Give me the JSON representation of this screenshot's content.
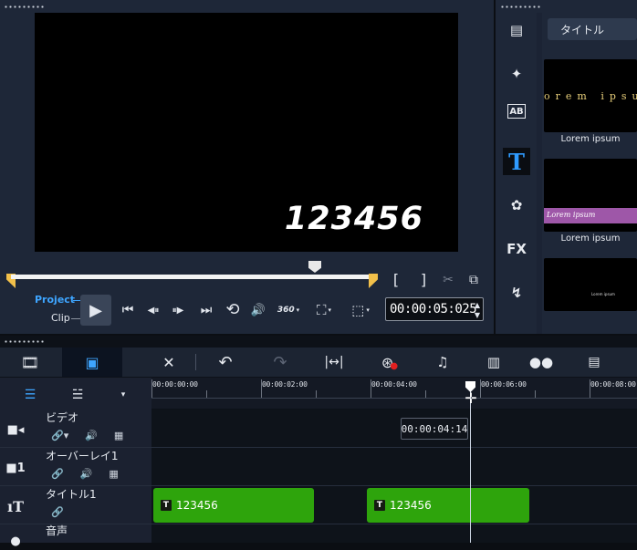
{
  "player": {
    "preview_text": "123456",
    "mode_project": "Project",
    "mode_clip": "Clip",
    "timecode": "00:00:05:025",
    "icons": {
      "play": "▶",
      "prev": "⏮",
      "step_back": "◀⏸",
      "step_fwd": "⏸▶",
      "next": "⏭",
      "repeat": "⟲",
      "volume": "🔊",
      "view360": "360",
      "aspect": "⛶",
      "crop": "⬚",
      "mark_in": "[",
      "mark_out": "]",
      "split": "✂",
      "snapshot": "⧉"
    }
  },
  "library": {
    "dropdown_label": "タイトル",
    "thumbs": [
      {
        "text": "orem ipsu",
        "label": "Lorem ipsum"
      },
      {
        "text": "Lorem ipsum",
        "label": "Lorem ipsum"
      },
      {
        "text": "Lorem ipsum"
      }
    ],
    "rail_title_icon": "T",
    "rail_fx": "FX",
    "rail_ab": "AB"
  },
  "timeline": {
    "ruler": [
      "00:00:00:00",
      "00:00:02:00",
      "00:00:04:00",
      "00:00:06:00",
      "00:00:08:00"
    ],
    "tooltip": "00:00:04:14",
    "tracks": [
      {
        "name": "ビデオ"
      },
      {
        "name": "オーバーレイ1"
      },
      {
        "name": "タイトル1"
      },
      {
        "name": "音声"
      }
    ],
    "clips": [
      {
        "label": "123456"
      },
      {
        "label": "123456"
      }
    ],
    "colors": {
      "clip": "#2ea40c",
      "accent": "#3ea5ff"
    }
  }
}
